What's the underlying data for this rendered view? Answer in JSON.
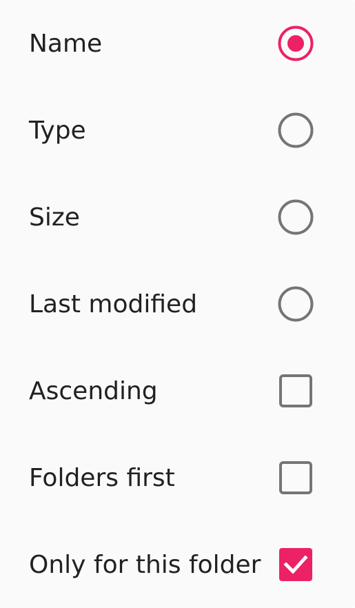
{
  "colors": {
    "accent": "#ec2166",
    "unselected": "#757575",
    "text": "#212121",
    "background": "#fafafa"
  },
  "sort_menu": {
    "items": [
      {
        "label": "Name",
        "control": "radio",
        "checked": true
      },
      {
        "label": "Type",
        "control": "radio",
        "checked": false
      },
      {
        "label": "Size",
        "control": "radio",
        "checked": false
      },
      {
        "label": "Last modified",
        "control": "radio",
        "checked": false
      },
      {
        "label": "Ascending",
        "control": "checkbox",
        "checked": false
      },
      {
        "label": "Folders first",
        "control": "checkbox",
        "checked": false
      },
      {
        "label": "Only for this folder",
        "control": "checkbox",
        "checked": true
      }
    ]
  }
}
